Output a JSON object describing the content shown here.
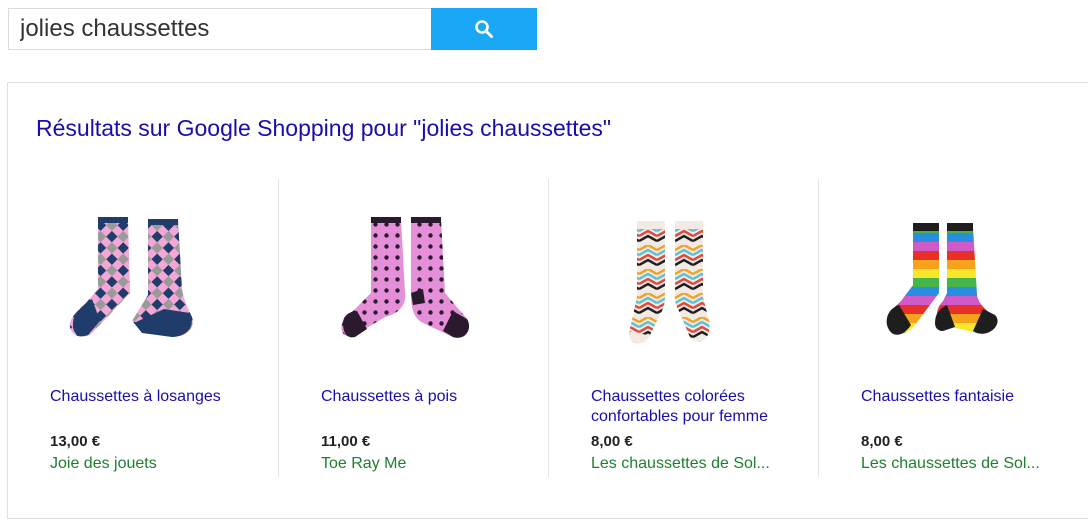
{
  "search": {
    "query": "jolies chaussettes",
    "button_icon": "search-icon",
    "accent": "#1aa8f6"
  },
  "shopping": {
    "title": "Résultats sur Google Shopping pour \"jolies chaussettes\"",
    "products": [
      {
        "title": "Chaussettes à losanges",
        "price": "13,00 €",
        "store": "Joie des jouets",
        "image": "argyle-socks-image"
      },
      {
        "title": "Chaussettes à pois",
        "price": "11,00 €",
        "store": "Toe Ray Me",
        "image": "polka-dot-socks-image"
      },
      {
        "title": "Chaussettes colorées confortables pour femme",
        "price": "8,00 €",
        "store": "Les chaussettes de Sol...",
        "image": "chevron-socks-image"
      },
      {
        "title": "Chaussettes fantaisie",
        "price": "8,00 €",
        "store": "Les chaussettes de Sol...",
        "image": "rainbow-striped-socks-image"
      }
    ]
  },
  "colors": {
    "link": "#1a0dab",
    "store": "#1e7f2e",
    "price": "#222222"
  }
}
